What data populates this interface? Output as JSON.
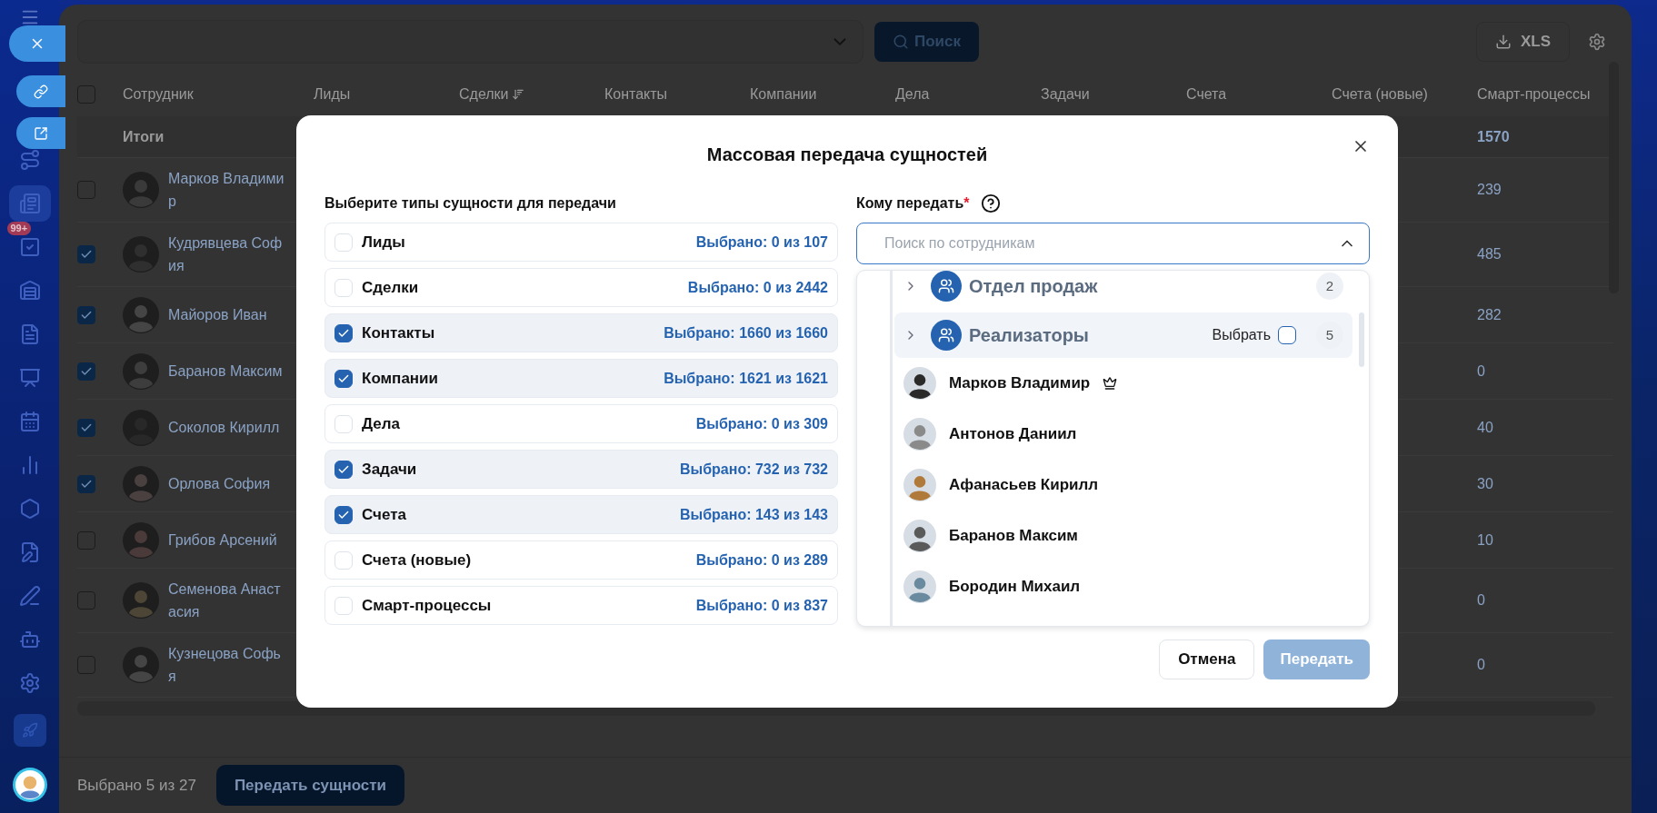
{
  "sidebar": {
    "task_badge": "99+"
  },
  "toolbar": {
    "search_button": "Поиск",
    "export_button": "XLS"
  },
  "table": {
    "all_checked": false,
    "columns": [
      {
        "label": "Сотрудник"
      },
      {
        "label": "Лиды"
      },
      {
        "label": "Сделки",
        "sorted": true
      },
      {
        "label": "Контакты"
      },
      {
        "label": "Компании"
      },
      {
        "label": "Дела"
      },
      {
        "label": "Задачи"
      },
      {
        "label": "Счета"
      },
      {
        "label": "Счета (новые)"
      },
      {
        "label": "Смарт-процессы"
      }
    ],
    "totals": {
      "label": "Итоги",
      "smart_processes": "1570"
    },
    "rows": [
      {
        "name": "Марков Владимир",
        "checked": false,
        "smart_processes": "239"
      },
      {
        "name": "Кудрявцева София",
        "checked": true,
        "smart_processes": "485"
      },
      {
        "name": "Майоров Иван",
        "checked": true,
        "smart_processes": "282"
      },
      {
        "name": "Баранов Максим",
        "checked": true,
        "smart_processes": "0"
      },
      {
        "name": "Соколов Кирилл",
        "checked": true,
        "smart_processes": "40"
      },
      {
        "name": "Орлова София",
        "checked": true,
        "smart_processes": "30"
      },
      {
        "name": "Грибов Арсений",
        "checked": false,
        "smart_processes": "10"
      },
      {
        "name": "Семенова Анастасия",
        "checked": false,
        "smart_processes": "0"
      },
      {
        "name": "Кузнецова Софья",
        "checked": false,
        "smart_processes": "0"
      }
    ]
  },
  "footer": {
    "selected_text": "Выбрано 5 из 27",
    "transfer_button": "Передать сущности"
  },
  "modal": {
    "title": "Массовая передача сущностей",
    "entity_label": "Выберите типы сущности для передачи",
    "entities": [
      {
        "label": "Лиды",
        "count": "Выбрано: 0 из 107",
        "checked": false
      },
      {
        "label": "Сделки",
        "count": "Выбрано: 0 из 2442",
        "checked": false
      },
      {
        "label": "Контакты",
        "count": "Выбрано: 1660 из 1660",
        "checked": true
      },
      {
        "label": "Компании",
        "count": "Выбрано: 1621 из 1621",
        "checked": true
      },
      {
        "label": "Дела",
        "count": "Выбрано: 0 из 309",
        "checked": false
      },
      {
        "label": "Задачи",
        "count": "Выбрано: 732 из 732",
        "checked": true
      },
      {
        "label": "Счета",
        "count": "Выбрано: 143 из 143",
        "checked": true
      },
      {
        "label": "Счета (новые)",
        "count": "Выбрано: 0 из 289",
        "checked": false
      },
      {
        "label": "Смарт-процессы",
        "count": "Выбрано: 0 из 837",
        "checked": false
      }
    ],
    "recipient_label": "Кому передать",
    "required_mark": "*",
    "search": {
      "placeholder": "Поиск по сотрудникам",
      "expanded": true
    },
    "groups": [
      {
        "name": "Отдел продаж",
        "count": "2",
        "highlighted": false
      },
      {
        "name": "Реализаторы",
        "count": "5",
        "highlighted": true,
        "select_label": "Выбрать",
        "checked": false
      }
    ],
    "employees": [
      {
        "name": "Марков Владимир",
        "head": true
      },
      {
        "name": "Антонов Даниил",
        "head": false
      },
      {
        "name": "Афанасьев Кирилл",
        "head": false
      },
      {
        "name": "Баранов Максим",
        "head": false
      },
      {
        "name": "Бородин Михаил",
        "head": false
      }
    ],
    "buttons": {
      "cancel": "Отмена",
      "submit": "Передать",
      "submit_disabled": true
    }
  }
}
